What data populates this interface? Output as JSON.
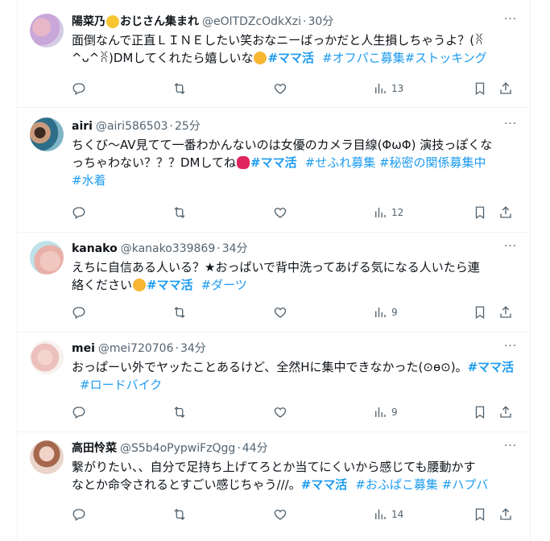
{
  "tweets": [
    {
      "name": "陽菜乃",
      "name_suffix": "おじさん集まれ",
      "handle": "@eOlTDZcOdkXzi",
      "separator": "·",
      "time": "30分",
      "body_lines": [
        "面倒なんで正直ＬＩＮＥしたい笑おなニーばっかだと人生損しちゃうよ？(ꐦ",
        "^ᴗ^ꐦ)DMしてくれたら嬉しいな"
      ],
      "tags": [
        "#ママ活",
        "#オフパこ募集",
        "#ストッキング"
      ],
      "views": "13"
    },
    {
      "name": "airi",
      "handle": "@airi586503",
      "separator": "·",
      "time": "25分",
      "body_lines": [
        "ちくび〜AV見てて一番わかんないのは女優のカメラ目線(ΦωΦ) 演技っぽくな",
        "っちゃわない？？？DMしてね"
      ],
      "tags": [
        "#ママ活",
        "#せふれ募集",
        "#秘密の関係募集中",
        "#水着"
      ],
      "views": "12"
    },
    {
      "name": "kanako",
      "handle": "@kanako339869",
      "separator": "·",
      "time": "34分",
      "body_lines": [
        "えちに自信ある人いる？★おっぱいで背中洗ってあげる気になる人いたら連",
        "絡ください"
      ],
      "tags": [
        "#ママ活",
        "#ダーツ"
      ],
      "views": "9"
    },
    {
      "name": "mei",
      "handle": "@mei720706",
      "separator": "·",
      "time": "34分",
      "body_lines": [
        "おっぱーい外でヤッたことあるけど、全然Hに集中できなかった(⊙ɵ⊙)。"
      ],
      "tags": [
        "#ママ活",
        "#ロードバイク"
      ],
      "views": "9"
    },
    {
      "name": "高田怜菜",
      "handle": "@S5b4oPypwiFzQgg",
      "separator": "·",
      "time": "44分",
      "body_lines": [
        "繋がりたい、、自分で足持ち上げてろとか当てにくいから感じても腰動かす",
        "なとか命令されるとすごい感じちゃう///。"
      ],
      "tags": [
        "#ママ活",
        "#おふぱこ募集",
        "#ハプバ"
      ],
      "views": "14"
    }
  ],
  "more_label": "···",
  "icons": {
    "reply": "reply-icon",
    "repost": "repost-icon",
    "like": "like-icon",
    "views": "views-icon",
    "bookmark": "bookmark-icon",
    "share": "share-icon"
  },
  "colors": {
    "hashtag": "#1d9bf0",
    "secondary": "#536471",
    "divider": "#eff3f4"
  }
}
